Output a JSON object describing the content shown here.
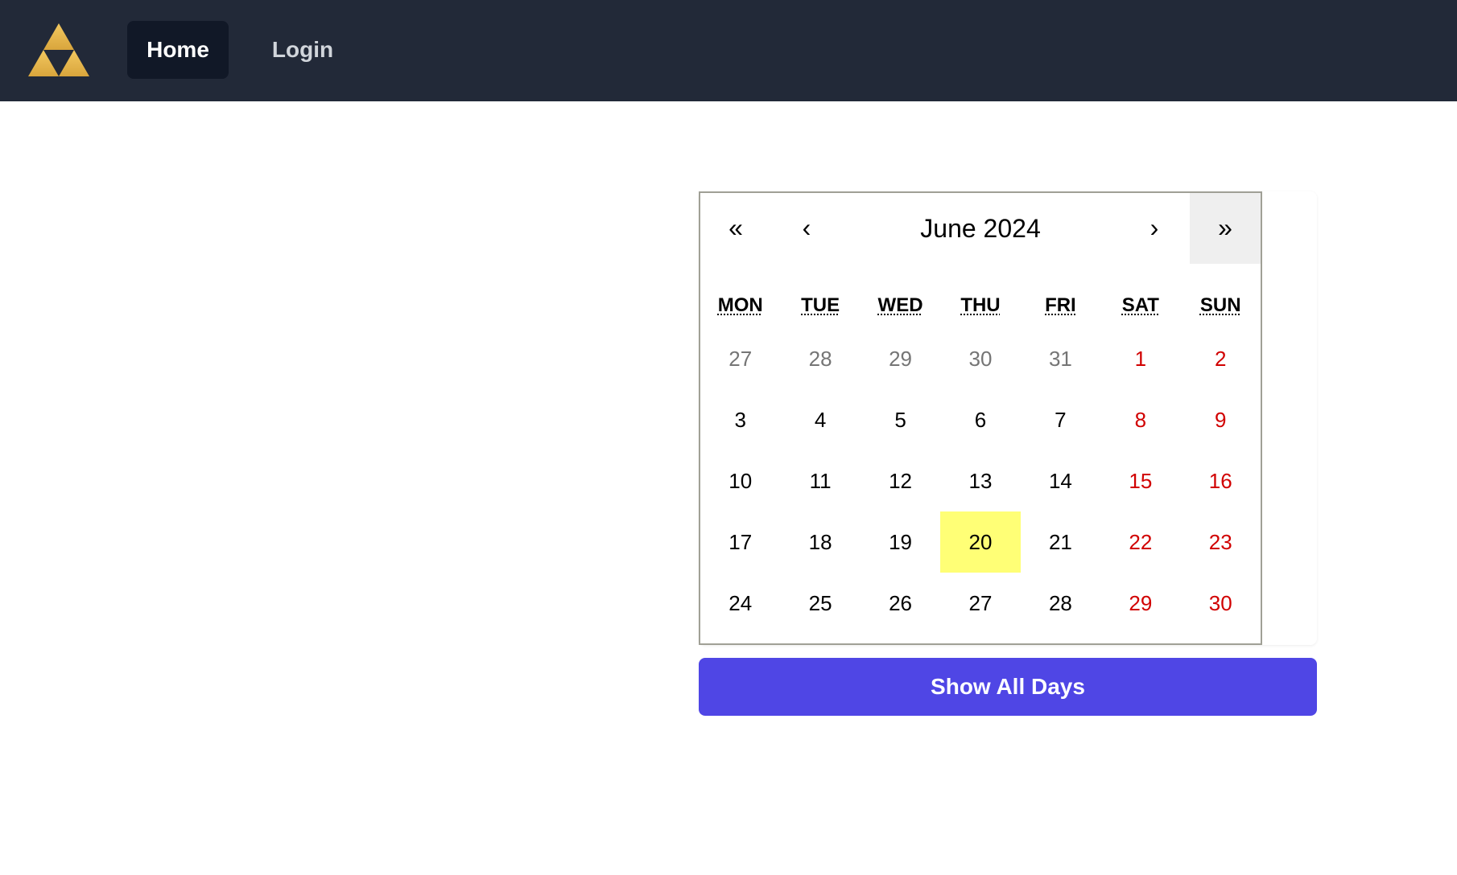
{
  "nav": {
    "home_label": "Home",
    "login_label": "Login",
    "logo_icon": "triforce-icon",
    "colors": {
      "bar": "#222938",
      "active": "#111827",
      "logo": "#e8b94e"
    }
  },
  "calendar": {
    "label": "June 2024",
    "prev2": "«",
    "prev": "‹",
    "next": "›",
    "next2": "»",
    "weekdays": [
      "MON",
      "TUE",
      "WED",
      "THU",
      "FRI",
      "SAT",
      "SUN"
    ],
    "weeks": [
      [
        {
          "day": "27",
          "type": "neighbor"
        },
        {
          "day": "28",
          "type": "neighbor"
        },
        {
          "day": "29",
          "type": "neighbor"
        },
        {
          "day": "30",
          "type": "neighbor"
        },
        {
          "day": "31",
          "type": "neighbor"
        },
        {
          "day": "1",
          "type": "weekend"
        },
        {
          "day": "2",
          "type": "weekend"
        }
      ],
      [
        {
          "day": "3",
          "type": "normal"
        },
        {
          "day": "4",
          "type": "normal"
        },
        {
          "day": "5",
          "type": "normal"
        },
        {
          "day": "6",
          "type": "normal"
        },
        {
          "day": "7",
          "type": "normal"
        },
        {
          "day": "8",
          "type": "weekend"
        },
        {
          "day": "9",
          "type": "weekend"
        }
      ],
      [
        {
          "day": "10",
          "type": "normal"
        },
        {
          "day": "11",
          "type": "normal"
        },
        {
          "day": "12",
          "type": "normal"
        },
        {
          "day": "13",
          "type": "normal"
        },
        {
          "day": "14",
          "type": "normal"
        },
        {
          "day": "15",
          "type": "weekend"
        },
        {
          "day": "16",
          "type": "weekend"
        }
      ],
      [
        {
          "day": "17",
          "type": "normal"
        },
        {
          "day": "18",
          "type": "normal"
        },
        {
          "day": "19",
          "type": "normal"
        },
        {
          "day": "20",
          "type": "today"
        },
        {
          "day": "21",
          "type": "normal"
        },
        {
          "day": "22",
          "type": "weekend"
        },
        {
          "day": "23",
          "type": "weekend"
        }
      ],
      [
        {
          "day": "24",
          "type": "normal"
        },
        {
          "day": "25",
          "type": "normal"
        },
        {
          "day": "26",
          "type": "normal"
        },
        {
          "day": "27",
          "type": "normal"
        },
        {
          "day": "28",
          "type": "normal"
        },
        {
          "day": "29",
          "type": "weekend"
        },
        {
          "day": "30",
          "type": "weekend"
        }
      ]
    ],
    "colors": {
      "weekend": "#d10000",
      "neighbor": "#757575",
      "today": "#ffff76"
    }
  },
  "show_all_button": {
    "label": "Show All Days",
    "color": "#4f46e5"
  }
}
